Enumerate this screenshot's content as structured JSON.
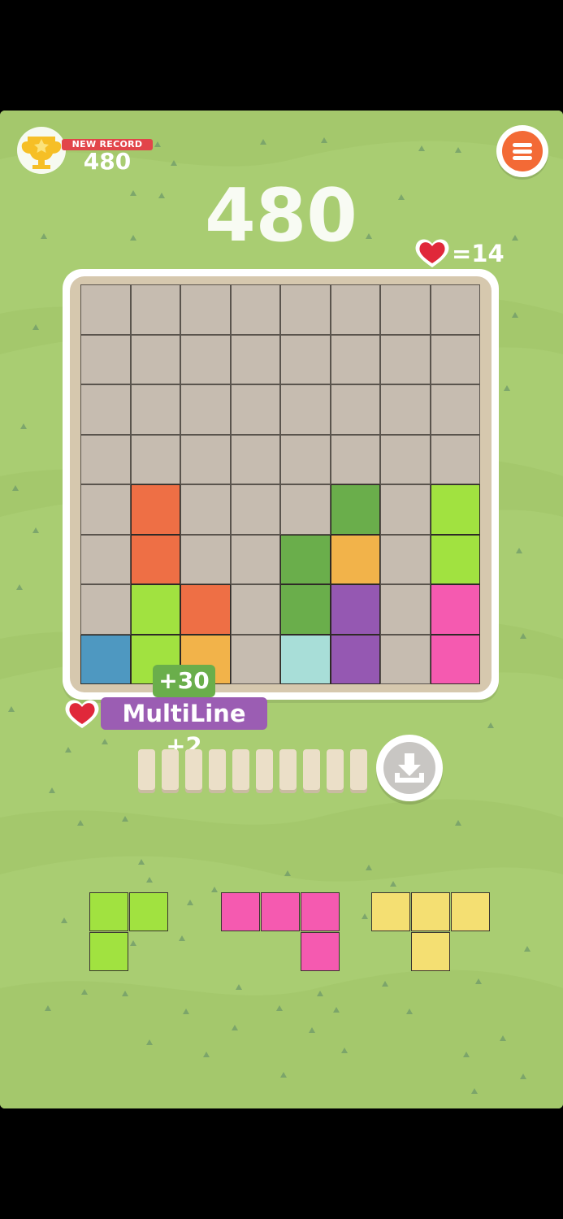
{
  "header": {
    "badge_label": "NEW RECORD",
    "best_score": "480",
    "score": "480",
    "lives_text": "=14"
  },
  "colors": {
    "background": "#a9cd72",
    "empty_cell": "#c6bcb0",
    "orange": "#ee6f45",
    "green": "#6aae4b",
    "lime": "#a1e240",
    "yellow": "#f2b34a",
    "purple": "#9558b2",
    "pink": "#f55ab0",
    "blue": "#4e98c1",
    "cyan": "#a8ded8",
    "light_yellow": "#f4df72",
    "menu": "#f36a36",
    "badge": "#e2454a"
  },
  "board": {
    "rows": 8,
    "cols": 8,
    "cells": [
      [
        null,
        null,
        null,
        null,
        null,
        null,
        null,
        null
      ],
      [
        null,
        null,
        null,
        null,
        null,
        null,
        null,
        null
      ],
      [
        null,
        null,
        null,
        null,
        null,
        null,
        null,
        null
      ],
      [
        null,
        null,
        null,
        null,
        null,
        null,
        null,
        null
      ],
      [
        null,
        "#ee6f45",
        null,
        null,
        null,
        "#6aae4b",
        null,
        "#a1e240"
      ],
      [
        null,
        "#ee6f45",
        null,
        null,
        "#6aae4b",
        "#f2b34a",
        null,
        "#a1e240"
      ],
      [
        null,
        "#a1e240",
        "#ee6f45",
        null,
        "#6aae4b",
        "#9558b2",
        null,
        "#f55ab0"
      ],
      [
        "#4e98c1",
        "#a1e240",
        "#f2b34a",
        null,
        "#a8ded8",
        "#9558b2",
        null,
        "#f55ab0"
      ]
    ]
  },
  "popups": {
    "points": "+30",
    "combo": "MultiLine +2"
  },
  "tokens": {
    "count": 10
  },
  "pieces": [
    {
      "name": "piece-lime",
      "color": "#a1e240",
      "cells": [
        [
          0,
          0
        ],
        [
          0,
          1
        ],
        [
          1,
          0
        ]
      ]
    },
    {
      "name": "piece-pink",
      "color": "#f55ab0",
      "cells": [
        [
          0,
          0
        ],
        [
          0,
          1
        ],
        [
          0,
          2
        ],
        [
          1,
          2
        ]
      ]
    },
    {
      "name": "piece-yellow",
      "color": "#f4df72",
      "cells": [
        [
          0,
          0
        ],
        [
          0,
          1
        ],
        [
          0,
          2
        ],
        [
          1,
          1
        ]
      ]
    }
  ],
  "icons": {
    "trophy": "trophy-icon",
    "menu": "menu-icon",
    "heart": "heart-icon",
    "drop": "drop-down-icon"
  }
}
